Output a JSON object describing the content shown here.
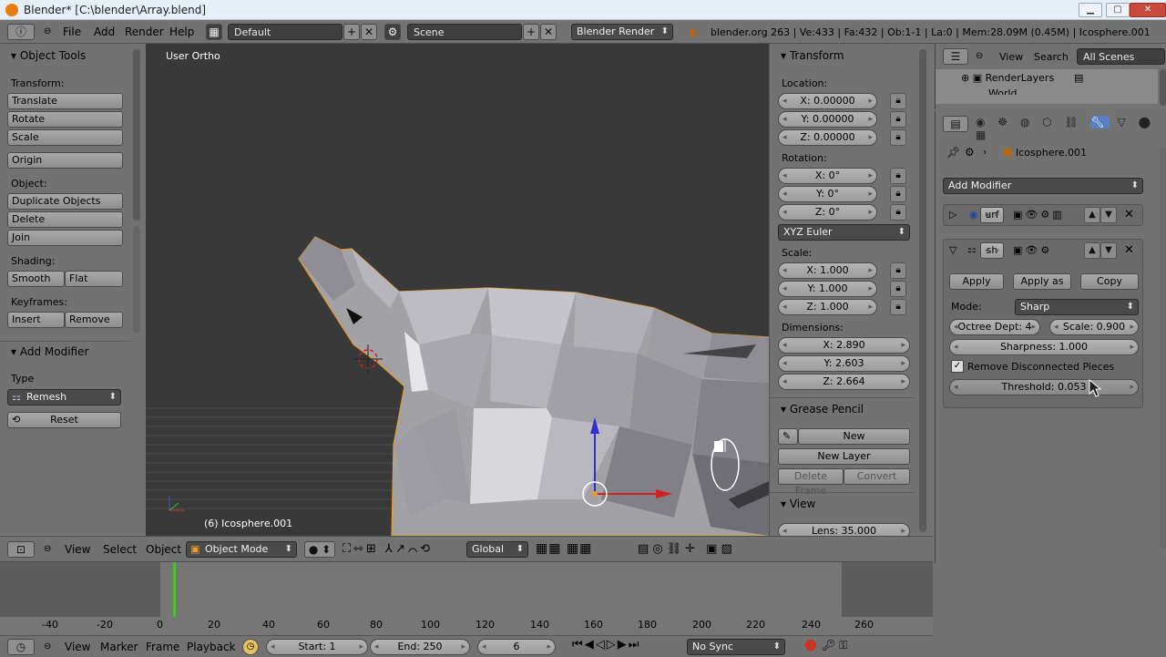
{
  "window": {
    "title": "Blender* [C:\\blender\\Array.blend]",
    "minimize": "▁",
    "maximize": "▢",
    "close": "✕"
  },
  "topbar": {
    "menus": [
      "File",
      "Add",
      "Render",
      "Help"
    ],
    "screen_layout": "Default",
    "scene": "Scene",
    "render_engine": "Blender Render",
    "stats": "blender.org 263 | Ve:433 | Fa:432 | Ob:1-1 | La:0 | Mem:28.09M (0.45M) | Icosphere.001"
  },
  "tools": {
    "header": "Object Tools",
    "transform_label": "Transform:",
    "translate": "Translate",
    "rotate": "Rotate",
    "scale": "Scale",
    "origin": "Origin",
    "object_label": "Object:",
    "duplicate": "Duplicate Objects",
    "delete": "Delete",
    "join": "Join",
    "shading_label": "Shading:",
    "smooth": "Smooth",
    "flat": "Flat",
    "keyframes_label": "Keyframes:",
    "insert": "Insert",
    "remove": "Remove",
    "add_modifier_header": "Add Modifier",
    "type_label": "Type",
    "type_value": "Remesh",
    "reset": "Reset"
  },
  "viewport": {
    "view_name": "User Ortho",
    "object_name": "(6) Icosphere.001"
  },
  "properties": {
    "transform_header": "Transform",
    "location_label": "Location:",
    "loc_x": "X: 0.00000",
    "loc_y": "Y: 0.00000",
    "loc_z": "Z: 0.00000",
    "rotation_label": "Rotation:",
    "rot_x": "X: 0°",
    "rot_y": "Y: 0°",
    "rot_z": "Z: 0°",
    "rotation_mode": "XYZ Euler",
    "scale_label": "Scale:",
    "scale_x": "X: 1.000",
    "scale_y": "Y: 1.000",
    "scale_z": "Z: 1.000",
    "dimensions_label": "Dimensions:",
    "dim_x": "X: 2.890",
    "dim_y": "Y: 2.603",
    "dim_z": "Z: 2.664",
    "grease_header": "Grease Pencil",
    "new": "New",
    "new_layer": "New Layer",
    "delete_frame": "Delete Frame",
    "convert": "Convert",
    "view_header": "View",
    "lens": "Lens: 35.000"
  },
  "outliner": {
    "view": "View",
    "search": "Search",
    "scenes": "All Scenes",
    "item1": "RenderLayers",
    "item2": "World"
  },
  "modifiers": {
    "object_name": "Icosphere.001",
    "add_modifier": "Add Modifier",
    "mod1_name": "urf",
    "mod2_name": "sh",
    "apply": "Apply",
    "apply_shape": "Apply as Sha",
    "copy": "Copy",
    "mode_label": "Mode:",
    "mode_value": "Sharp",
    "octree": "Octree Dept: 4",
    "scale": "Scale: 0.900",
    "sharpness": "Sharpness: 1.000",
    "remove_disconnected": "Remove Disconnected Pieces",
    "threshold": "Threshold: 0.053"
  },
  "view3d_header": {
    "view": "View",
    "select": "Select",
    "object": "Object",
    "mode": "Object Mode",
    "orientation": "Global"
  },
  "timeline": {
    "ticks": [
      "-40",
      "-20",
      "0",
      "20",
      "40",
      "60",
      "80",
      "100",
      "120",
      "140",
      "160",
      "180",
      "200",
      "220",
      "240",
      "260"
    ],
    "view": "View",
    "marker": "Marker",
    "frame": "Frame",
    "playback": "Playback",
    "start": "Start: 1",
    "end": "End: 250",
    "current": "6",
    "sync": "No Sync"
  }
}
